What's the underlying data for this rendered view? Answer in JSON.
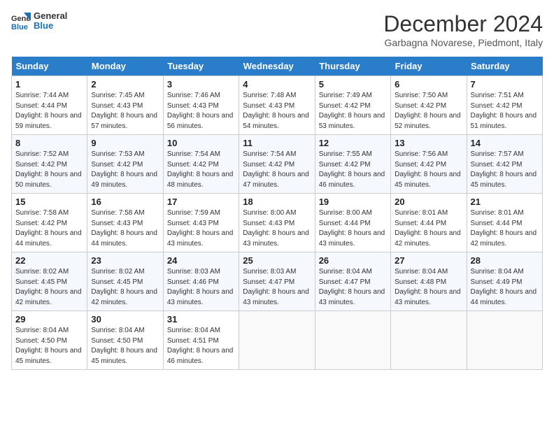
{
  "header": {
    "logo_line1": "General",
    "logo_line2": "Blue",
    "month_title": "December 2024",
    "location": "Garbagna Novarese, Piedmont, Italy"
  },
  "days_of_week": [
    "Sunday",
    "Monday",
    "Tuesday",
    "Wednesday",
    "Thursday",
    "Friday",
    "Saturday"
  ],
  "weeks": [
    [
      {
        "day": "1",
        "sunrise": "7:44 AM",
        "sunset": "4:44 PM",
        "daylight": "8 hours and 59 minutes."
      },
      {
        "day": "2",
        "sunrise": "7:45 AM",
        "sunset": "4:43 PM",
        "daylight": "8 hours and 57 minutes."
      },
      {
        "day": "3",
        "sunrise": "7:46 AM",
        "sunset": "4:43 PM",
        "daylight": "8 hours and 56 minutes."
      },
      {
        "day": "4",
        "sunrise": "7:48 AM",
        "sunset": "4:43 PM",
        "daylight": "8 hours and 54 minutes."
      },
      {
        "day": "5",
        "sunrise": "7:49 AM",
        "sunset": "4:42 PM",
        "daylight": "8 hours and 53 minutes."
      },
      {
        "day": "6",
        "sunrise": "7:50 AM",
        "sunset": "4:42 PM",
        "daylight": "8 hours and 52 minutes."
      },
      {
        "day": "7",
        "sunrise": "7:51 AM",
        "sunset": "4:42 PM",
        "daylight": "8 hours and 51 minutes."
      }
    ],
    [
      {
        "day": "8",
        "sunrise": "7:52 AM",
        "sunset": "4:42 PM",
        "daylight": "8 hours and 50 minutes."
      },
      {
        "day": "9",
        "sunrise": "7:53 AM",
        "sunset": "4:42 PM",
        "daylight": "8 hours and 49 minutes."
      },
      {
        "day": "10",
        "sunrise": "7:54 AM",
        "sunset": "4:42 PM",
        "daylight": "8 hours and 48 minutes."
      },
      {
        "day": "11",
        "sunrise": "7:54 AM",
        "sunset": "4:42 PM",
        "daylight": "8 hours and 47 minutes."
      },
      {
        "day": "12",
        "sunrise": "7:55 AM",
        "sunset": "4:42 PM",
        "daylight": "8 hours and 46 minutes."
      },
      {
        "day": "13",
        "sunrise": "7:56 AM",
        "sunset": "4:42 PM",
        "daylight": "8 hours and 45 minutes."
      },
      {
        "day": "14",
        "sunrise": "7:57 AM",
        "sunset": "4:42 PM",
        "daylight": "8 hours and 45 minutes."
      }
    ],
    [
      {
        "day": "15",
        "sunrise": "7:58 AM",
        "sunset": "4:42 PM",
        "daylight": "8 hours and 44 minutes."
      },
      {
        "day": "16",
        "sunrise": "7:58 AM",
        "sunset": "4:43 PM",
        "daylight": "8 hours and 44 minutes."
      },
      {
        "day": "17",
        "sunrise": "7:59 AM",
        "sunset": "4:43 PM",
        "daylight": "8 hours and 43 minutes."
      },
      {
        "day": "18",
        "sunrise": "8:00 AM",
        "sunset": "4:43 PM",
        "daylight": "8 hours and 43 minutes."
      },
      {
        "day": "19",
        "sunrise": "8:00 AM",
        "sunset": "4:44 PM",
        "daylight": "8 hours and 43 minutes."
      },
      {
        "day": "20",
        "sunrise": "8:01 AM",
        "sunset": "4:44 PM",
        "daylight": "8 hours and 42 minutes."
      },
      {
        "day": "21",
        "sunrise": "8:01 AM",
        "sunset": "4:44 PM",
        "daylight": "8 hours and 42 minutes."
      }
    ],
    [
      {
        "day": "22",
        "sunrise": "8:02 AM",
        "sunset": "4:45 PM",
        "daylight": "8 hours and 42 minutes."
      },
      {
        "day": "23",
        "sunrise": "8:02 AM",
        "sunset": "4:45 PM",
        "daylight": "8 hours and 42 minutes."
      },
      {
        "day": "24",
        "sunrise": "8:03 AM",
        "sunset": "4:46 PM",
        "daylight": "8 hours and 43 minutes."
      },
      {
        "day": "25",
        "sunrise": "8:03 AM",
        "sunset": "4:47 PM",
        "daylight": "8 hours and 43 minutes."
      },
      {
        "day": "26",
        "sunrise": "8:04 AM",
        "sunset": "4:47 PM",
        "daylight": "8 hours and 43 minutes."
      },
      {
        "day": "27",
        "sunrise": "8:04 AM",
        "sunset": "4:48 PM",
        "daylight": "8 hours and 43 minutes."
      },
      {
        "day": "28",
        "sunrise": "8:04 AM",
        "sunset": "4:49 PM",
        "daylight": "8 hours and 44 minutes."
      }
    ],
    [
      {
        "day": "29",
        "sunrise": "8:04 AM",
        "sunset": "4:50 PM",
        "daylight": "8 hours and 45 minutes."
      },
      {
        "day": "30",
        "sunrise": "8:04 AM",
        "sunset": "4:50 PM",
        "daylight": "8 hours and 45 minutes."
      },
      {
        "day": "31",
        "sunrise": "8:04 AM",
        "sunset": "4:51 PM",
        "daylight": "8 hours and 46 minutes."
      },
      {
        "day": "",
        "sunrise": "",
        "sunset": "",
        "daylight": ""
      },
      {
        "day": "",
        "sunrise": "",
        "sunset": "",
        "daylight": ""
      },
      {
        "day": "",
        "sunrise": "",
        "sunset": "",
        "daylight": ""
      },
      {
        "day": "",
        "sunrise": "",
        "sunset": "",
        "daylight": ""
      }
    ]
  ]
}
